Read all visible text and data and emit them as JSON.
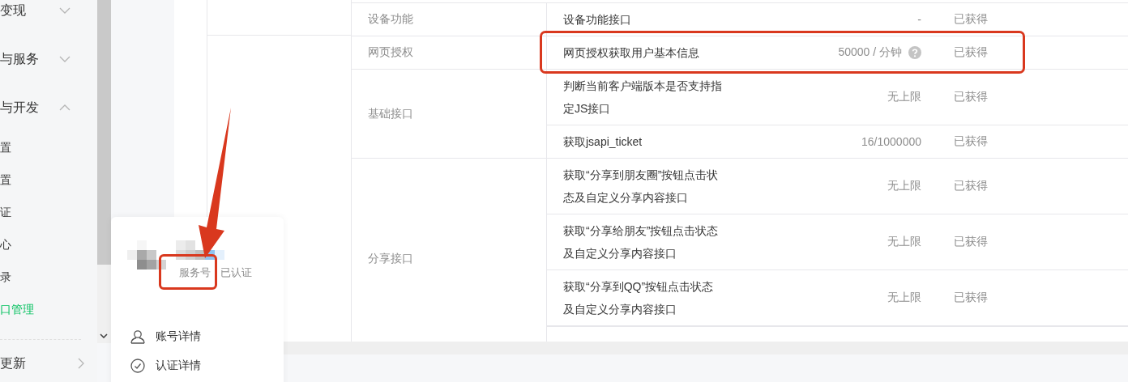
{
  "sidebar": {
    "items": [
      {
        "label": "变现",
        "expanded": false
      },
      {
        "label": "与服务",
        "expanded": false
      },
      {
        "label": "与开发",
        "expanded": true,
        "children": [
          {
            "label": "置",
            "selected": false
          },
          {
            "label": "置",
            "selected": false
          },
          {
            "label": "证",
            "selected": false
          },
          {
            "label": "心",
            "selected": false
          },
          {
            "label": "录",
            "selected": false
          },
          {
            "label": "口管理",
            "selected": true
          }
        ]
      }
    ],
    "footer_item": {
      "label": "更新"
    }
  },
  "table": {
    "sections": [
      {
        "category": "设备功能",
        "items": [
          {
            "name": "设备功能接口",
            "limit": "-",
            "help": false,
            "status": "已获得",
            "highlighted": false
          }
        ]
      },
      {
        "category": "网页授权",
        "items": [
          {
            "name": "网页授权获取用户基本信息",
            "limit": "50000 / 分钟",
            "help": true,
            "status": "已获得",
            "highlighted": true
          }
        ]
      },
      {
        "category": "基础接口",
        "items": [
          {
            "name": "判断当前客户端版本是否支持指定JS接口",
            "limit": "无上限",
            "help": false,
            "status": "已获得",
            "highlighted": false
          },
          {
            "name": "获取jsapi_ticket",
            "limit": "16/1000000",
            "help": false,
            "status": "已获得",
            "highlighted": false
          }
        ]
      },
      {
        "category": "分享接口",
        "items": [
          {
            "name": "获取“分享到朋友圈”按钮点击状态及自定义分享内容接口",
            "limit": "无上限",
            "help": false,
            "status": "已获得",
            "highlighted": false
          },
          {
            "name": "获取“分享给朋友”按钮点击状态及自定义分享内容接口",
            "limit": "无上限",
            "help": false,
            "status": "已获得",
            "highlighted": false
          },
          {
            "name": "获取“分享到QQ”按钮点击状态及自定义分享内容接口",
            "limit": "无上限",
            "help": false,
            "status": "已获得",
            "highlighted": false
          }
        ]
      }
    ]
  },
  "account_card": {
    "name_redacted": true,
    "type": "服务号",
    "type_highlighted": true,
    "status": "已认证",
    "pointer_arrow": true,
    "menu": [
      {
        "kind": "account",
        "label": "账号详情"
      },
      {
        "kind": "verification",
        "label": "认证详情"
      }
    ]
  }
}
